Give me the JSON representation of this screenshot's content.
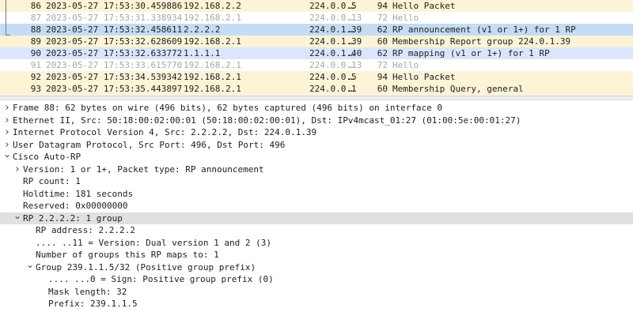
{
  "packet_list": {
    "rows": [
      {
        "no": "86",
        "time": "2023-05-27 17:53:30.459886",
        "source": "192.168.2.2",
        "destination": "224.0.0.5",
        "ellipsis": "…",
        "length": "94",
        "info": "Hello Packet",
        "bg": "#fdf3d6",
        "fg": "#1e1e1e"
      },
      {
        "no": "87",
        "time": "2023-05-27 17:53:31.338934",
        "source": "192.168.2.1",
        "destination": "224.0.0.13",
        "ellipsis": "…",
        "length": "72",
        "info": "Hello",
        "bg": "#ffffff",
        "fg": "#a6a6a6"
      },
      {
        "no": "88",
        "time": "2023-05-27 17:53:32.458611",
        "source": "2.2.2.2",
        "destination": "224.0.1.39",
        "ellipsis": "…",
        "length": "62",
        "info": "RP announcement (v1 or 1+) for 1 RP",
        "bg": "#c4dcf4",
        "fg": "#1e1e1e"
      },
      {
        "no": "89",
        "time": "2023-05-27 17:53:32.628609",
        "source": "192.168.2.1",
        "destination": "224.0.1.39",
        "ellipsis": "…",
        "length": "60",
        "info": "Membership Report group 224.0.1.39",
        "bg": "#fdf3d6",
        "fg": "#1e1e1e"
      },
      {
        "no": "90",
        "time": "2023-05-27 17:53:32.633772",
        "source": "1.1.1.1",
        "destination": "224.0.1.40",
        "ellipsis": "…",
        "length": "62",
        "info": "RP mapping (v1 or 1+) for 1 RP",
        "bg": "#dbe6fb",
        "fg": "#1e1e1e"
      },
      {
        "no": "91",
        "time": "2023-05-27 17:53:33.615770",
        "source": "192.168.2.1",
        "destination": "224.0.0.13",
        "ellipsis": "…",
        "length": "72",
        "info": "Hello",
        "bg": "#ffffff",
        "fg": "#a6a6a6"
      },
      {
        "no": "92",
        "time": "2023-05-27 17:53:34.539342",
        "source": "192.168.2.1",
        "destination": "224.0.0.5",
        "ellipsis": "…",
        "length": "94",
        "info": "Hello Packet",
        "bg": "#fdf3d6",
        "fg": "#1e1e1e"
      },
      {
        "no": "93",
        "time": "2023-05-27 17:53:35.443897",
        "source": "192.168.2.1",
        "destination": "224.0.0.1",
        "ellipsis": "…",
        "length": "60",
        "info": "Membership Query, general",
        "bg": "#fdf3d6",
        "fg": "#1e1e1e"
      }
    ]
  },
  "details": {
    "rows": [
      {
        "level": 0,
        "arrow": "collapsed",
        "text": "Frame 88: 62 bytes on wire (496 bits), 62 bytes captured (496 bits) on interface 0"
      },
      {
        "level": 0,
        "arrow": "collapsed",
        "text": "Ethernet II, Src: 50:18:00:02:00:01 (50:18:00:02:00:01), Dst: IPv4mcast_01:27 (01:00:5e:00:01:27)"
      },
      {
        "level": 0,
        "arrow": "collapsed",
        "text": "Internet Protocol Version 4, Src: 2.2.2.2, Dst: 224.0.1.39"
      },
      {
        "level": 0,
        "arrow": "collapsed",
        "text": "User Datagram Protocol, Src Port: 496, Dst Port: 496"
      },
      {
        "level": 0,
        "arrow": "expanded",
        "text": "Cisco Auto-RP"
      },
      {
        "level": 1,
        "arrow": "collapsed",
        "text": "Version: 1 or 1+, Packet type: RP announcement"
      },
      {
        "level": 1,
        "arrow": "none",
        "text": "RP count: 1"
      },
      {
        "level": 1,
        "arrow": "none",
        "text": "Holdtime: 181 seconds"
      },
      {
        "level": 1,
        "arrow": "none",
        "text": "Reserved: 0x00000000"
      },
      {
        "level": 1,
        "arrow": "expanded",
        "text": "RP 2.2.2.2: 1 group",
        "selected": true
      },
      {
        "level": 2,
        "arrow": "none",
        "text": "RP address: 2.2.2.2"
      },
      {
        "level": 2,
        "arrow": "none",
        "text": ".... ..11 = Version: Dual version 1 and 2 (3)"
      },
      {
        "level": 2,
        "arrow": "none",
        "text": "Number of groups this RP maps to: 1"
      },
      {
        "level": 2,
        "arrow": "expanded",
        "text": "Group 239.1.1.5/32 (Positive group prefix)"
      },
      {
        "level": 3,
        "arrow": "none",
        "text": ".... ...0 = Sign: Positive group prefix (0)"
      },
      {
        "level": 3,
        "arrow": "none",
        "text": "Mask length: 32"
      },
      {
        "level": 3,
        "arrow": "none",
        "text": "Prefix: 239.1.1.5"
      }
    ]
  },
  "colors": {
    "selected_packet": "#c4dcf4",
    "selected_detail": "#e0e0e0",
    "ospf_row": "#fdf3d6",
    "eigrp_text": "#a6a6a6"
  }
}
